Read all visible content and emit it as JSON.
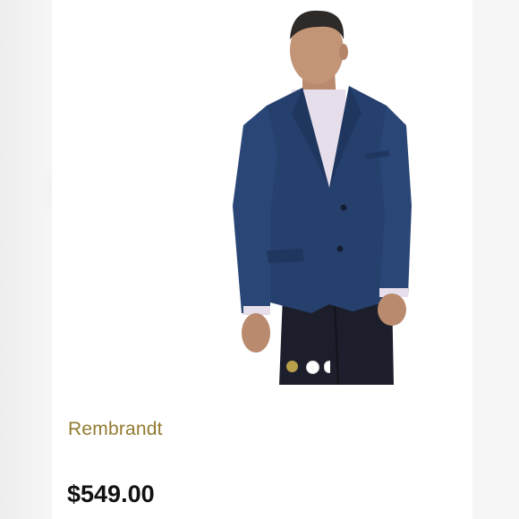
{
  "product": {
    "brand_name": "Rembrandt",
    "price": "$549.00",
    "image_alt": "Model wearing a navy wool sport coat over a lavender shirt and dark trousers"
  },
  "carousel": {
    "total_dots_visible": 3,
    "active_index": 0
  },
  "colors": {
    "brand_gold": "#927a2f",
    "active_dot": "#b8a04a",
    "jacket_navy": "#26406e",
    "shirt_lavender": "#e6deea",
    "trousers": "#1c1f2b"
  }
}
